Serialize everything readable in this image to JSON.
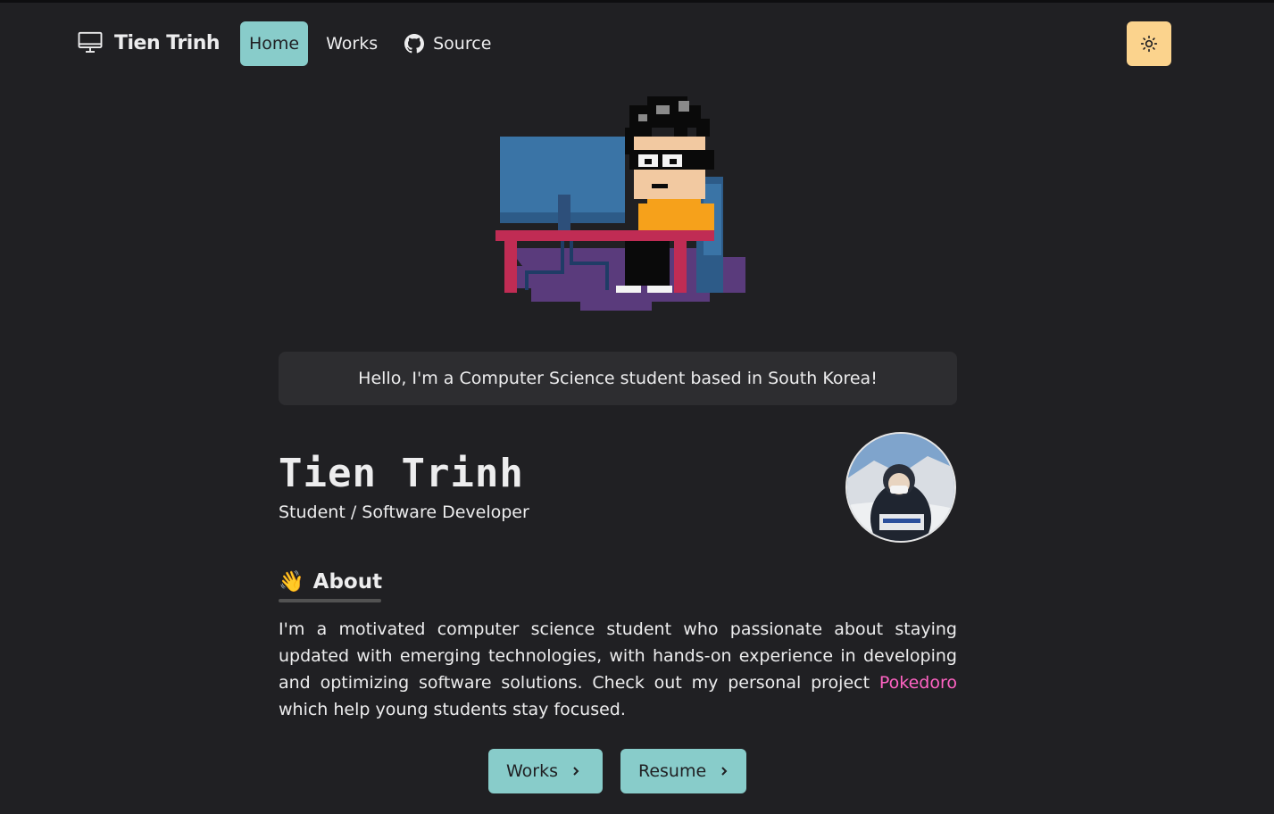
{
  "nav": {
    "brand": "Tien Trinh",
    "links": [
      {
        "label": "Home",
        "active": true
      },
      {
        "label": "Works",
        "active": false
      },
      {
        "label": "Source",
        "active": false,
        "icon": "github-icon"
      }
    ],
    "theme_toggle_icon": "sun-icon",
    "accent": "#88ccca",
    "theme_toggle_color": "#fbd38d"
  },
  "greeting": "Hello, I'm a Computer Science student based in South Korea!",
  "profile": {
    "name": "Tien Trinh",
    "role": "Student / Software Developer"
  },
  "about": {
    "emoji": "👋",
    "title": "About",
    "text_before": "I'm a motivated computer science student who passionate about staying updated with emerging technologies, with hands-on experience in developing and optimizing software solutions. Check out my personal project ",
    "link_text": "Pokedoro",
    "text_after": " which help young students stay focused.",
    "link_color": "#ff63c3"
  },
  "buttons": {
    "works": "Works",
    "resume": "Resume"
  }
}
